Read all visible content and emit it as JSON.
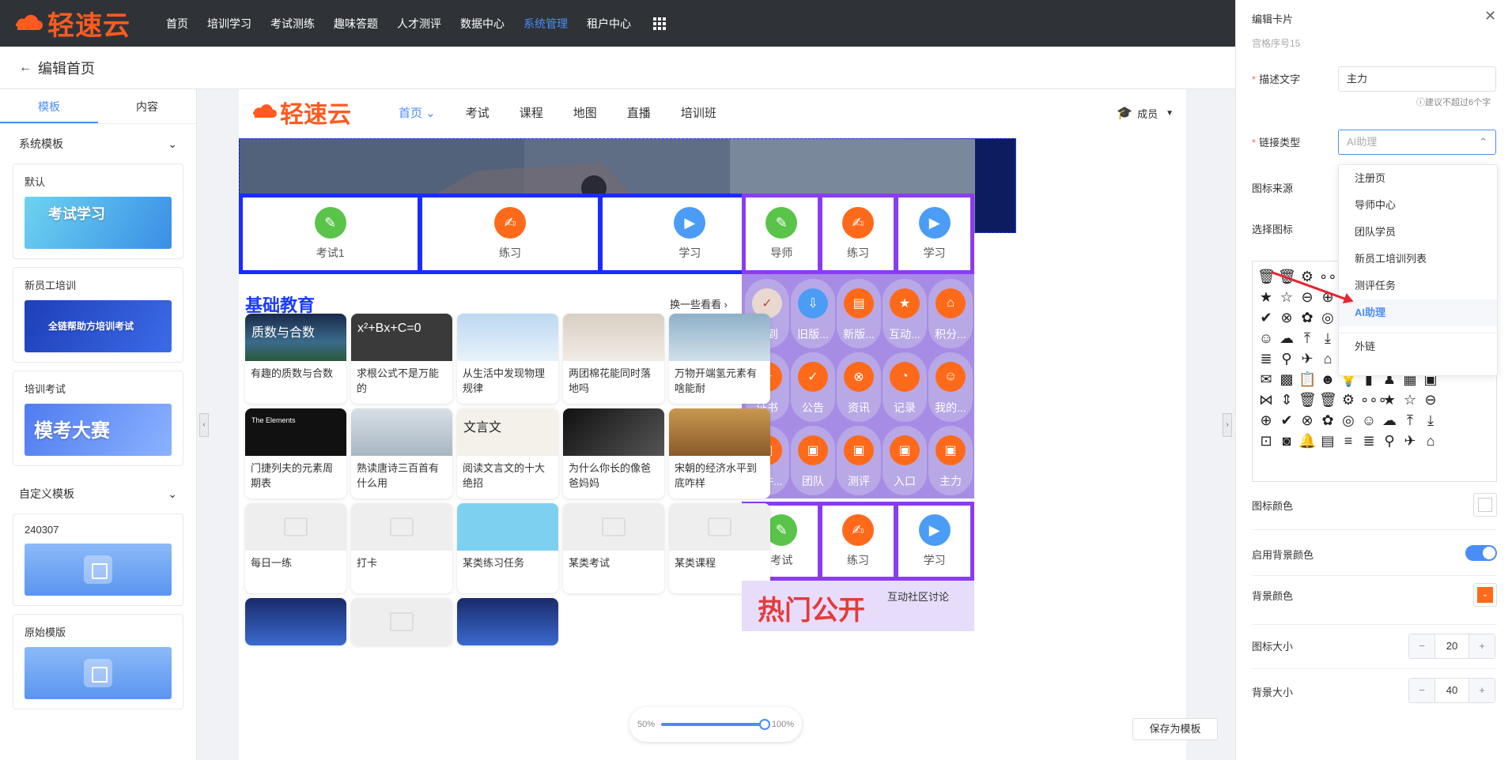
{
  "topbar": {
    "brand": "轻速云",
    "nav": [
      "首页",
      "培训学习",
      "考试测练",
      "趣味答题",
      "人才测评",
      "数据中心",
      "系统管理",
      "租户中心"
    ],
    "active_index": 6
  },
  "subhead": {
    "back": "←",
    "title": "编辑首页"
  },
  "left": {
    "tabs": [
      "模板",
      "内容"
    ],
    "sys_section": "系统模板",
    "sys_templates": [
      {
        "name": "默认",
        "thumb_text": "考试学习"
      },
      {
        "name": "新员工培训",
        "thumb_text": "全链帮助方培训考试"
      },
      {
        "name": "培训考试",
        "thumb_text": "模考大赛"
      }
    ],
    "custom_section": "自定义模板",
    "custom_templates": [
      {
        "name": "240307"
      },
      {
        "name": "原始模版"
      }
    ]
  },
  "preview": {
    "brand": "轻速云",
    "links": [
      "首页",
      "考试",
      "课程",
      "地图",
      "直播",
      "培训班"
    ],
    "member": "成员",
    "block1": [
      {
        "label": "考试1",
        "color": "g",
        "icon": "✎"
      },
      {
        "label": "练习",
        "color": "o",
        "icon": "✍"
      },
      {
        "label": "学习",
        "color": "b",
        "icon": "▶"
      }
    ],
    "block2": [
      {
        "label": "导师",
        "color": "g",
        "icon": "✎"
      },
      {
        "label": "练习",
        "color": "o",
        "icon": "✍"
      },
      {
        "label": "学习",
        "color": "b",
        "icon": "▶"
      }
    ],
    "block3": [
      {
        "label": "考试",
        "color": "g",
        "icon": "✎"
      },
      {
        "label": "练习",
        "color": "o",
        "icon": "✍"
      },
      {
        "label": "学习",
        "color": "b",
        "icon": "▶"
      }
    ],
    "grid_items": [
      "签到",
      "旧版...",
      "新版...",
      "互动...",
      "积分...",
      "证书",
      "公告",
      "资讯",
      "记录",
      "我的...",
      "课件...",
      "团队",
      "测评",
      "入口",
      "主力"
    ],
    "section_title": "基础教育",
    "section_more": "换一些看看",
    "courses": [
      "有趣的质数与合数",
      "求根公式不是万能的",
      "从生活中发现物理规律",
      "两团棉花能同时落地吗",
      "万物开端氢元素有啥能耐",
      "门捷列夫的元素周期表",
      "熟读唐诗三百首有什么用",
      "阅读文言文的十大绝招",
      "为什么你长的像爸爸妈妈",
      "宋朝的经济水平到底咋样",
      "每日一练",
      "打卡",
      "某类练习任务",
      "某类考试",
      "某类课程"
    ],
    "course_thumb_texts": {
      "0": "质数与合数",
      "1": "x²+Bx+C=0",
      "5": "The Elements",
      "7": "文言文"
    },
    "hot_title": "热门公开",
    "hot_sub": "互动社区讨论"
  },
  "zoom": {
    "min": "50%",
    "max": "100%"
  },
  "save_template": "保存为模板",
  "right": {
    "title": "编辑卡片",
    "subtitle": "宫格序号15",
    "desc_label": "描述文字",
    "desc_value": "主力",
    "desc_hint": "建议不超过6个字",
    "link_label": "链接类型",
    "link_placeholder": "AI助理",
    "icon_source_label": "图标来源",
    "choose_icon_label": "选择图标",
    "dropdown": [
      "注册页",
      "导师中心",
      "团队学员",
      "新员工培训列表",
      "测评任务",
      "AI助理",
      "外链"
    ],
    "dropdown_selected": 5,
    "icon_color_label": "图标颜色",
    "bg_enable_label": "启用背景颜色",
    "bg_color_label": "背景颜色",
    "bg_color": "#ff6a1a",
    "icon_size_label": "图标大小",
    "icon_size": "20",
    "bg_size_label": "背景大小",
    "bg_size": "40"
  }
}
